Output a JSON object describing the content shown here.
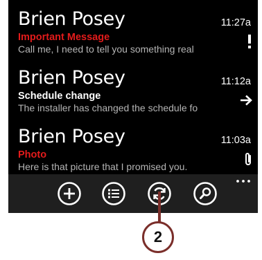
{
  "emails": [
    {
      "sender": "Brien Posey",
      "subject": "Important Message",
      "subject_color": "#e31b1b",
      "preview": "Call me, I need to tell you something real",
      "time": "11:27a",
      "flag_icon": "high-importance-icon"
    },
    {
      "sender": "Brien Posey",
      "subject": "Schedule change",
      "subject_color": "#ffffff",
      "preview": "The installer has changed the schedule fo",
      "time": "11:12a",
      "flag_icon": "forwarded-icon"
    },
    {
      "sender": "Brien Posey",
      "subject": "Photo",
      "subject_color": "#e31b1b",
      "preview": "Here is that picture that I promised you.",
      "time": "11:03a",
      "flag_icon": "attachment-icon"
    }
  ],
  "app_bar": {
    "buttons": [
      "new-icon",
      "select-icon",
      "sync-icon",
      "search-icon"
    ],
    "more": "ellipsis-icon"
  },
  "callout": {
    "label": "2",
    "color": "#7a2e2a"
  }
}
